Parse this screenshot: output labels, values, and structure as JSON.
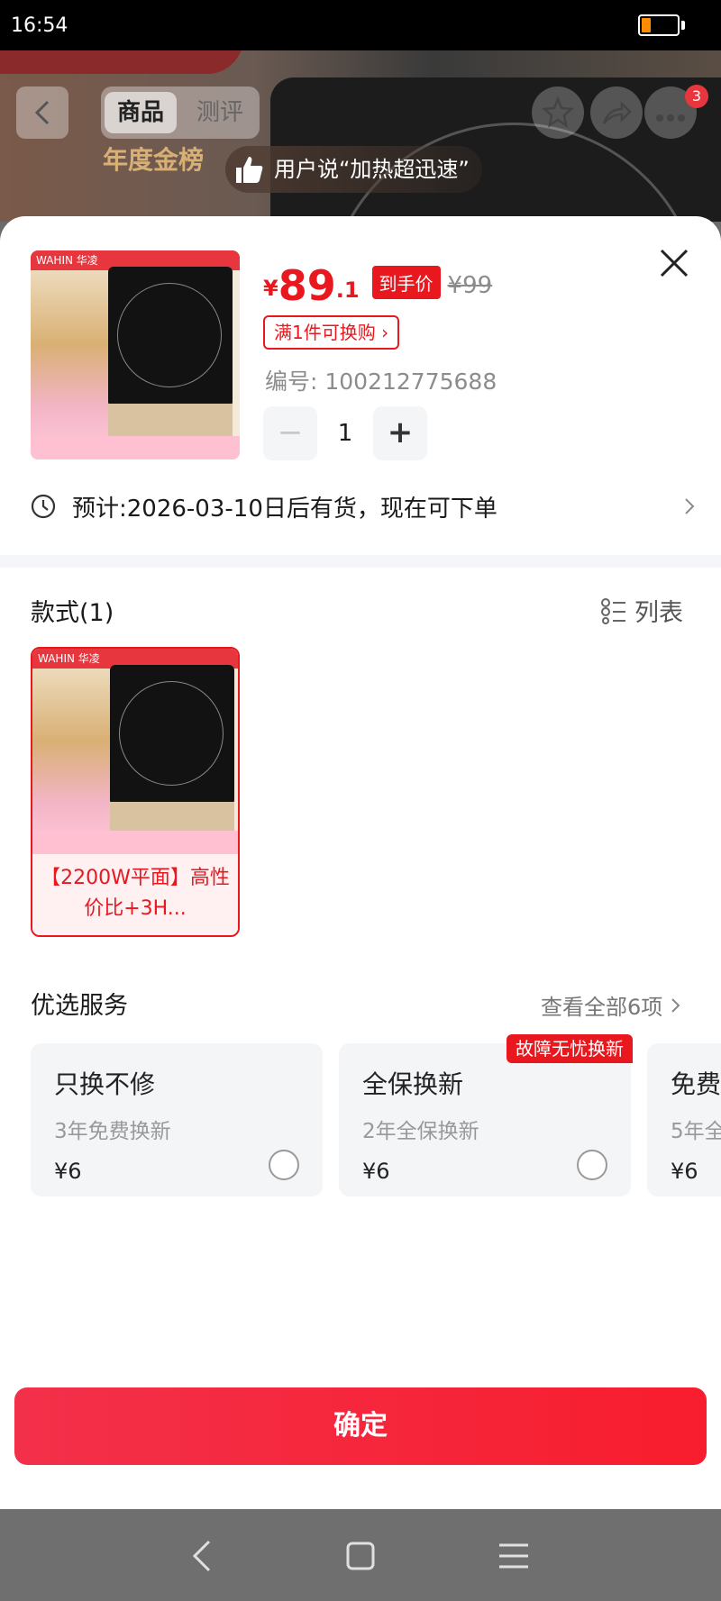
{
  "status_bar": {
    "time": "16:54"
  },
  "background": {
    "tabs": [
      "商品",
      "测评"
    ],
    "gold_badge": "年度金榜",
    "review_quote": "用户说“加热超迅速”",
    "cart_badge_count": "3"
  },
  "product": {
    "price_yen": "¥",
    "price_int": "89",
    "price_dec": ".1",
    "price_label": "到手价",
    "original_price": "¥99",
    "promo": "满1件可换购 ›",
    "sku": "编号: 100212775688",
    "quantity": "1",
    "brand_logo": "WAHIN 华凌"
  },
  "eta": {
    "text": "预计:2026-03-10日后有货，现在可下单"
  },
  "styles": {
    "header": "款式(1)",
    "list_toggle": "列表",
    "items": [
      {
        "label": "【2200W平面】高性价比+3H..."
      }
    ]
  },
  "services": {
    "header": "优选服务",
    "view_all": "查看全部6项",
    "ribbon": "故障无忧换新",
    "items": [
      {
        "title": "只换不修",
        "subtitle": "3年免费换新",
        "price": "¥6"
      },
      {
        "title": "全保换新",
        "subtitle": "2年全保换新",
        "price": "¥6"
      },
      {
        "title": "免费",
        "subtitle": "5年全",
        "price": "¥6"
      }
    ]
  },
  "confirm": {
    "label": "确定"
  },
  "colors": {
    "accent": "#e8181e",
    "confirm_gradient_start": "#f3304a",
    "confirm_gradient_end": "#f81d2e"
  }
}
